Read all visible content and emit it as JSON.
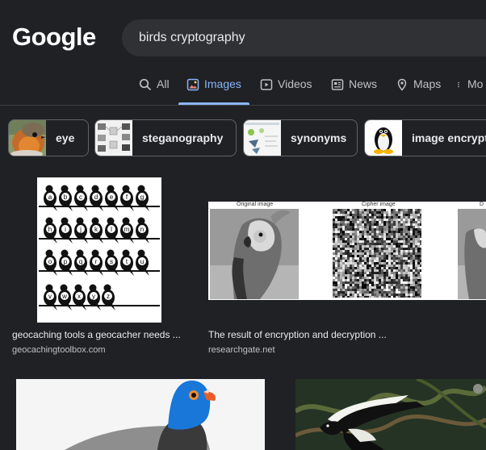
{
  "logo": "Google",
  "search": {
    "query": "birds cryptography"
  },
  "tabs": [
    {
      "label": "All",
      "icon": "search-icon"
    },
    {
      "label": "Images",
      "icon": "image-icon",
      "active": true
    },
    {
      "label": "Videos",
      "icon": "play-icon"
    },
    {
      "label": "News",
      "icon": "news-icon"
    },
    {
      "label": "Maps",
      "icon": "map-pin-icon"
    },
    {
      "label": "Mo",
      "icon": "more-dots-icon"
    }
  ],
  "chips": [
    {
      "label": "eye",
      "thumb": "robin-bird-thumb"
    },
    {
      "label": "steganography",
      "thumb": "steganography-diagram-thumb"
    },
    {
      "label": "synonyms",
      "thumb": "synonyms-diagram-thumb"
    },
    {
      "label": "image encrypt",
      "thumb": "linux-penguin-thumb"
    }
  ],
  "results": [
    {
      "caption": "geocaching tools a geocacher needs ...",
      "source": "geocachingtoolbox.com",
      "letters": [
        "a",
        "b",
        "c",
        "d",
        "e",
        "f",
        "g",
        "h",
        "i",
        "j",
        "k",
        "l",
        "m",
        "n",
        "o",
        "p",
        "q",
        "r",
        "s",
        "t",
        "u",
        "v",
        "w",
        "x",
        "y",
        "z"
      ]
    },
    {
      "caption": "The result of encryption and decryption ...",
      "source": "researchgate.net",
      "labels": [
        "Original image",
        "Cipher image",
        "D"
      ]
    },
    {
      "caption": "",
      "source": ""
    },
    {
      "caption": "",
      "source": ""
    }
  ],
  "colors": {
    "background": "#202124",
    "search_bg": "#303134",
    "accent": "#8ab4f8",
    "text": "#e8eaed",
    "muted": "#bdc1c6"
  }
}
